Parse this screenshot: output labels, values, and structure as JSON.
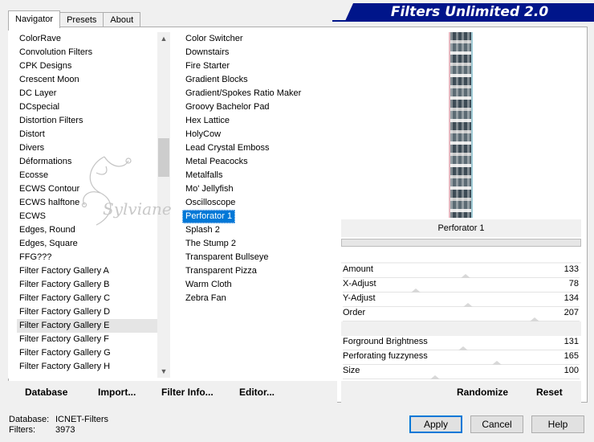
{
  "tabs": {
    "navigator": "Navigator",
    "presets": "Presets",
    "about": "About"
  },
  "banner": {
    "title": "Filters Unlimited 2.0"
  },
  "categories": {
    "items": [
      "ColorRave",
      "Convolution Filters",
      "CPK Designs",
      "Crescent Moon",
      "DC Layer",
      "DCspecial",
      "Distortion Filters",
      "Distort",
      "Divers",
      "Déformations",
      "Ecosse",
      "ECWS Contour",
      "ECWS halftone",
      "ECWS",
      "Edges, Round",
      "Edges, Square",
      "FFG???",
      "Filter Factory Gallery A",
      "Filter Factory Gallery B",
      "Filter Factory Gallery C",
      "Filter Factory Gallery D",
      "Filter Factory Gallery E",
      "Filter Factory Gallery F",
      "Filter Factory Gallery G",
      "Filter Factory Gallery H"
    ],
    "selected_index": 21
  },
  "filters": {
    "items": [
      "Color Switcher",
      "Downstairs",
      "Fire Starter",
      "Gradient Blocks",
      "Gradient/Spokes Ratio Maker",
      "Groovy Bachelor Pad",
      "Hex Lattice",
      "HolyCow",
      "Lead Crystal Emboss",
      "Metal Peacocks",
      "Metalfalls",
      "Mo' Jellyfish",
      "Oscilloscope",
      "Perforator 1",
      "Splash 2",
      "The Stump 2",
      "Transparent Bullseye",
      "Transparent Pizza",
      "Warm Cloth",
      "Zebra Fan"
    ],
    "selected_index": 13
  },
  "preview": {
    "filter_name": "Perforator 1"
  },
  "params": [
    {
      "label": "Amount",
      "value": "133",
      "level": 0.52
    },
    {
      "label": "X-Adjust",
      "value": "78",
      "level": 0.31
    },
    {
      "label": "Y-Adjust",
      "value": "134",
      "level": 0.53
    },
    {
      "label": "Order",
      "value": "207",
      "level": 0.81
    },
    {
      "label": "Forground Brightness",
      "value": "131",
      "level": 0.51
    },
    {
      "label": "Perforating fuzzyness",
      "value": "165",
      "level": 0.65
    },
    {
      "label": "Size",
      "value": "100",
      "level": 0.39
    }
  ],
  "bottom_links": {
    "database": "Database",
    "import": "Import...",
    "filter_info": "Filter Info...",
    "editor": "Editor...",
    "randomize": "Randomize",
    "reset": "Reset"
  },
  "status": {
    "database_label": "Database:",
    "database_value": "ICNET-Filters",
    "filters_label": "Filters:",
    "filters_value": "3973"
  },
  "buttons": {
    "apply": "Apply",
    "cancel": "Cancel",
    "help": "Help"
  },
  "watermark": {
    "text": "Sylviane"
  }
}
